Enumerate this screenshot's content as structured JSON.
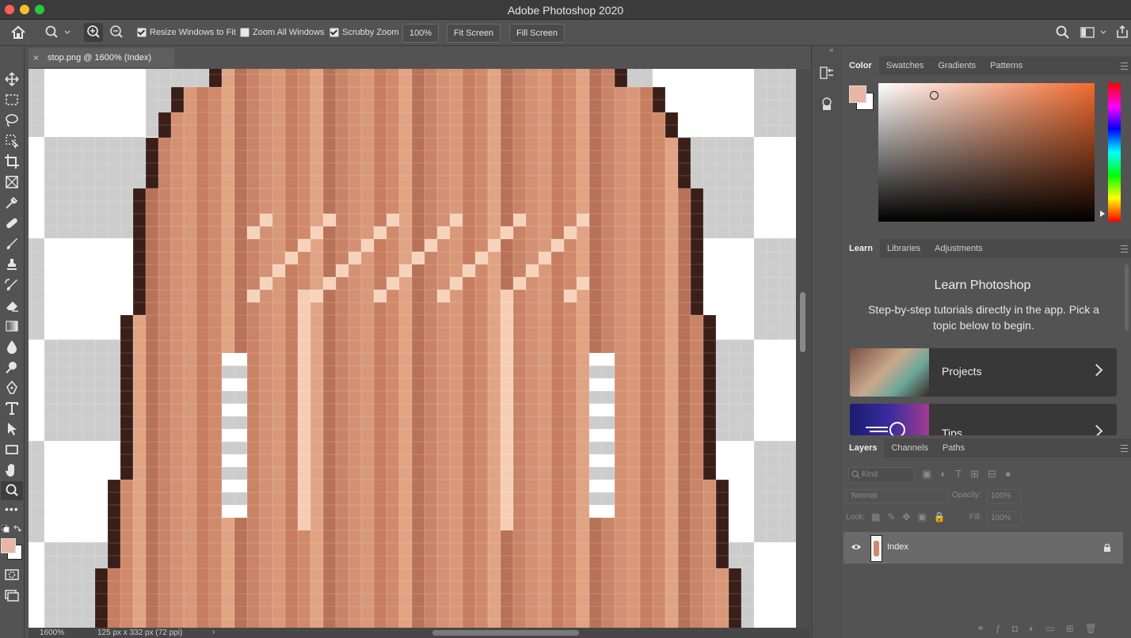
{
  "window": {
    "title": "Adobe Photoshop 2020"
  },
  "options_bar": {
    "resize_windows": "Resize Windows to Fit",
    "zoom_all": "Zoom All Windows",
    "scrubby_zoom": "Scrubby Zoom",
    "zoom_value": "100%",
    "fit_screen": "Fit Screen",
    "fill_screen": "Fill Screen"
  },
  "document": {
    "tab_title": "stop.png @ 1600% (Index)",
    "zoom": "1600%",
    "doc_info": "125 px x 332 px (72 ppi)"
  },
  "panels": {
    "color_tabs": [
      "Color",
      "Swatches",
      "Gradients",
      "Patterns"
    ],
    "learn_tabs": [
      "Learn",
      "Libraries",
      "Adjustments"
    ],
    "layers_tabs": [
      "Layers",
      "Channels",
      "Paths"
    ],
    "foreground_color": "#e9b6a4",
    "background_color": "#ffffff"
  },
  "learn": {
    "heading": "Learn Photoshop",
    "description": "Step-by-step tutorials directly in the app. Pick a topic below to begin.",
    "cards": [
      "Projects",
      "Tips"
    ]
  },
  "layers": {
    "kind_placeholder": "Kind",
    "blend_mode": "Normal",
    "opacity_label": "Opacity:",
    "opacity_value": "100%",
    "lock_label": "Lock:",
    "fill_label": "Fill:",
    "fill_value": "100%",
    "items": [
      {
        "name": "Index",
        "visible": true,
        "locked": true
      }
    ]
  }
}
